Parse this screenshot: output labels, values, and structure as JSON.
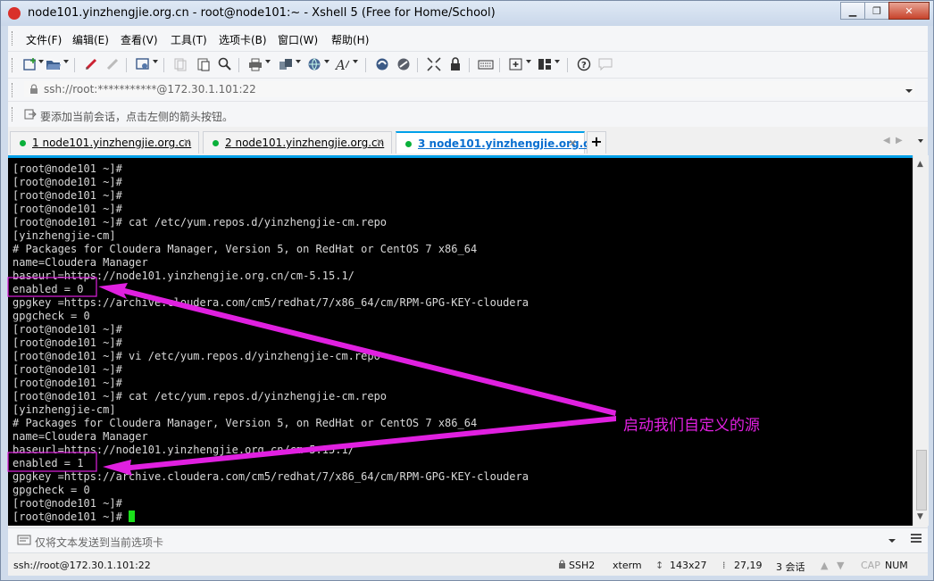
{
  "window": {
    "title": "node101.yinzhengjie.org.cn - root@node101:~ - Xshell 5 (Free for Home/School)",
    "min_glyph": "▁",
    "max_glyph": "❐",
    "close_glyph": "✕"
  },
  "menu": [
    "文件(F)",
    "编辑(E)",
    "查看(V)",
    "工具(T)",
    "选项卡(B)",
    "窗口(W)",
    "帮助(H)"
  ],
  "address": {
    "value": "ssh://root:***********@172.30.1.101:22",
    "lock_icon": "lock-icon"
  },
  "hint": "要添加当前会话，点击左侧的箭头按钮。",
  "tabs": [
    {
      "num": "1",
      "label": "node101.yinzhengjie.org.cn",
      "active": false
    },
    {
      "num": "2",
      "label": "node101.yinzhengjie.org.cn",
      "active": false
    },
    {
      "num": "3",
      "label": "node101.yinzhengjie.org.cn",
      "active": true
    }
  ],
  "tab_plus": "+",
  "tab_close": "✕",
  "terminal": {
    "lines": [
      "[root@node101 ~]#",
      "[root@node101 ~]#",
      "[root@node101 ~]#",
      "[root@node101 ~]#",
      "[root@node101 ~]# cat /etc/yum.repos.d/yinzhengjie-cm.repo",
      "[yinzhengjie-cm]",
      "# Packages for Cloudera Manager, Version 5, on RedHat or CentOS 7 x86_64",
      "name=Cloudera Manager",
      "baseurl=https://node101.yinzhengjie.org.cn/cm-5.15.1/",
      "enabled = 0",
      "gpgkey =https://archive.cloudera.com/cm5/redhat/7/x86_64/cm/RPM-GPG-KEY-cloudera",
      "gpgcheck = 0",
      "[root@node101 ~]#",
      "[root@node101 ~]#",
      "[root@node101 ~]# vi /etc/yum.repos.d/yinzhengjie-cm.repo",
      "[root@node101 ~]#",
      "[root@node101 ~]#",
      "[root@node101 ~]# cat /etc/yum.repos.d/yinzhengjie-cm.repo",
      "[yinzhengjie-cm]",
      "# Packages for Cloudera Manager, Version 5, on RedHat or CentOS 7 x86_64",
      "name=Cloudera Manager",
      "baseurl=https://node101.yinzhengjie.org.cn/cm-5.15.1/",
      "enabled = 1",
      "gpgkey =https://archive.cloudera.com/cm5/redhat/7/x86_64/cm/RPM-GPG-KEY-cloudera",
      "gpgcheck = 0",
      "[root@node101 ~]#",
      "[root@node101 ~]# "
    ]
  },
  "annotation": {
    "text": "启动我们自定义的源",
    "color": "#e020e0"
  },
  "sendbar": {
    "placeholder": "仅将文本发送到当前选项卡"
  },
  "status": {
    "connection": "ssh://root@172.30.1.101:22",
    "protocol": "SSH2",
    "terminal": "xterm",
    "size": "143x27",
    "position": "27,19",
    "sessions": "3 会话",
    "caps": "CAP",
    "num": "NUM"
  },
  "colors": {
    "accent": "#00a0e9",
    "cursor": "#1ae01a",
    "tab_dot": "#0ab03a"
  }
}
